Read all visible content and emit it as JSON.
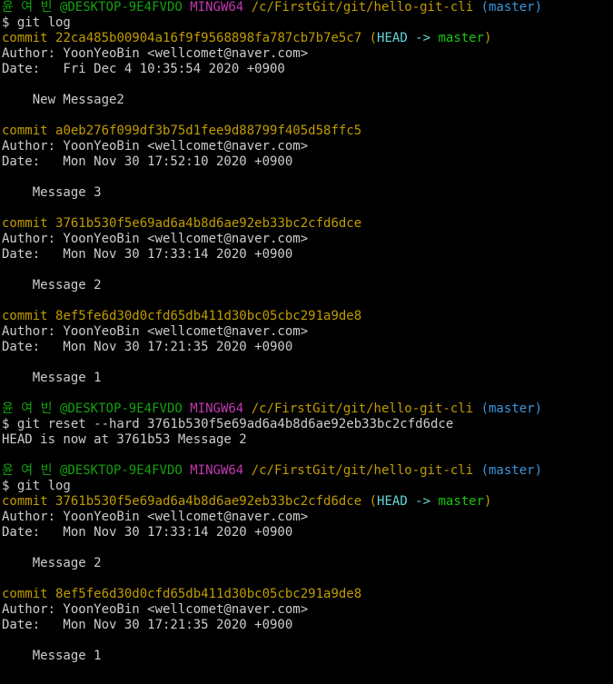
{
  "prompt": {
    "user": "윤 여 빈",
    "host": "@DESKTOP-9E4FVDO",
    "env": "MINGW64",
    "path": "/c/FirstGit/git/hello-git-cli",
    "branch": "(master)",
    "symbol": "$"
  },
  "colors": {
    "user": "#13a10e",
    "env": "#c239b3",
    "path": "#c19c00",
    "branch": "#3a96dd",
    "commit": "#c19c00",
    "head": "#61d6d6",
    "master": "#16c60c",
    "text": "#cccccc",
    "background": "#000000"
  },
  "lines": [
    {
      "type": "prompt"
    },
    {
      "type": "command",
      "text": "$ git log"
    },
    {
      "type": "commit",
      "label": "commit",
      "hash": "22ca485b00904a16f9f9568898fa787cb7b7e5c7",
      "ref": true
    },
    {
      "type": "text",
      "text": "Author: YoonYeoBin <wellcomet@naver.com>"
    },
    {
      "type": "text",
      "text": "Date:   Fri Dec 4 10:35:54 2020 +0900"
    },
    {
      "type": "blank"
    },
    {
      "type": "text",
      "text": "    New Message2"
    },
    {
      "type": "blank"
    },
    {
      "type": "commit",
      "label": "commit",
      "hash": "a0eb276f099df3b75d1fee9d88799f405d58ffc5",
      "ref": false
    },
    {
      "type": "text",
      "text": "Author: YoonYeoBin <wellcomet@naver.com>"
    },
    {
      "type": "text",
      "text": "Date:   Mon Nov 30 17:52:10 2020 +0900"
    },
    {
      "type": "blank"
    },
    {
      "type": "text",
      "text": "    Message 3"
    },
    {
      "type": "blank"
    },
    {
      "type": "commit",
      "label": "commit",
      "hash": "3761b530f5e69ad6a4b8d6ae92eb33bc2cfd6dce",
      "ref": false
    },
    {
      "type": "text",
      "text": "Author: YoonYeoBin <wellcomet@naver.com>"
    },
    {
      "type": "text",
      "text": "Date:   Mon Nov 30 17:33:14 2020 +0900"
    },
    {
      "type": "blank"
    },
    {
      "type": "text",
      "text": "    Message 2"
    },
    {
      "type": "blank"
    },
    {
      "type": "commit",
      "label": "commit",
      "hash": "8ef5fe6d30d0cfd65db411d30bc05cbc291a9de8",
      "ref": false
    },
    {
      "type": "text",
      "text": "Author: YoonYeoBin <wellcomet@naver.com>"
    },
    {
      "type": "text",
      "text": "Date:   Mon Nov 30 17:21:35 2020 +0900"
    },
    {
      "type": "blank"
    },
    {
      "type": "text",
      "text": "    Message 1"
    },
    {
      "type": "blank"
    },
    {
      "type": "prompt"
    },
    {
      "type": "command",
      "text": "$ git reset --hard 3761b530f5e69ad6a4b8d6ae92eb33bc2cfd6dce"
    },
    {
      "type": "text",
      "text": "HEAD is now at 3761b53 Message 2"
    },
    {
      "type": "blank"
    },
    {
      "type": "prompt"
    },
    {
      "type": "command",
      "text": "$ git log"
    },
    {
      "type": "commit",
      "label": "commit",
      "hash": "3761b530f5e69ad6a4b8d6ae92eb33bc2cfd6dce",
      "ref": true
    },
    {
      "type": "text",
      "text": "Author: YoonYeoBin <wellcomet@naver.com>"
    },
    {
      "type": "text",
      "text": "Date:   Mon Nov 30 17:33:14 2020 +0900"
    },
    {
      "type": "blank"
    },
    {
      "type": "text",
      "text": "    Message 2"
    },
    {
      "type": "blank"
    },
    {
      "type": "commit",
      "label": "commit",
      "hash": "8ef5fe6d30d0cfd65db411d30bc05cbc291a9de8",
      "ref": false
    },
    {
      "type": "text",
      "text": "Author: YoonYeoBin <wellcomet@naver.com>"
    },
    {
      "type": "text",
      "text": "Date:   Mon Nov 30 17:21:35 2020 +0900"
    },
    {
      "type": "blank"
    },
    {
      "type": "text",
      "text": "    Message 1"
    }
  ],
  "ref_label": {
    "open": "(",
    "head": "HEAD",
    "arrow": "->",
    "master": "master",
    "close": ")"
  }
}
